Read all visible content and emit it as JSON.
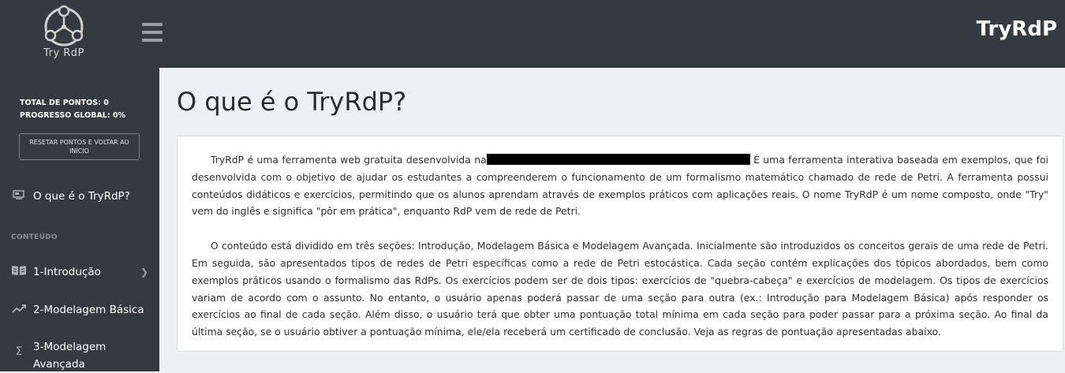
{
  "header": {
    "logo_text": "Try RdP",
    "app_title": "TryRdP"
  },
  "sidebar": {
    "total_points": "TOTAL DE PONTOS: 0",
    "global_progress": "PROGRESSO GLOBAL: 0%",
    "reset_button": "RESETAR PONTOS E VOLTAR AO INÍCIO",
    "about_item": "O que é o TryRdP?",
    "section_label": "CONTEÚDO",
    "items": [
      {
        "label": "1-Introdução",
        "icon": "book-icon"
      },
      {
        "label": "2-Modelagem Básica",
        "icon": "trend-icon"
      },
      {
        "label": "3-Modelagem Avançada",
        "icon": "sigma-icon"
      }
    ]
  },
  "main": {
    "title": "O que é o TryRdP?",
    "paragraph1_before": "TryRdP é uma ferramenta web gratuita desenvolvida na",
    "paragraph1_after": " É uma ferramenta interativa baseada em exemplos, que foi desenvolvida com o objetivo de ajudar os estudantes a compreenderem o funcionamento de um formalismo matemático chamado de rede de Petri. A ferramenta possui conteúdos didáticos e exercícios, permitindo que os alunos aprendam através de exemplos práticos com aplicações reais. O nome TryRdP é um nome composto, onde \"Try\" vem do inglês e significa \"pôr em prática\", enquanto RdP vem de rede de Petri.",
    "paragraph2": "O conteúdo está dividido em três seções: Introdução, Modelagem Básica e Modelagem Avançada. Inicialmente são introduzidos os conceitos gerais de uma rede de Petri. Em seguida, são apresentados tipos de redes de Petri específicas como a rede de Petri estocástica. Cada seção contém explicações dos tópicos abordados, bem como exemplos práticos usando o formalismo das RdPs. Os exercícios podem ser de dois tipos: exercícios de \"quebra-cabeça\" e exercícios de modelagem. Os tipos de exercícios variam de acordo com o assunto. No entanto, o usuário apenas poderá passar de uma seção para outra (ex.: Introdução para Modelagem Básica) após responder os exercícios ao final de cada seção. Além disso, o usuário terá que obter uma pontuação total mínima em cada seção para poder passar para a próxima seção. Ao final da última seção, se o usuário obtiver a pontuação mínima, ele/ela receberá um certificado de conclusão. Veja as regras de pontuação apresentadas abaixo."
  }
}
